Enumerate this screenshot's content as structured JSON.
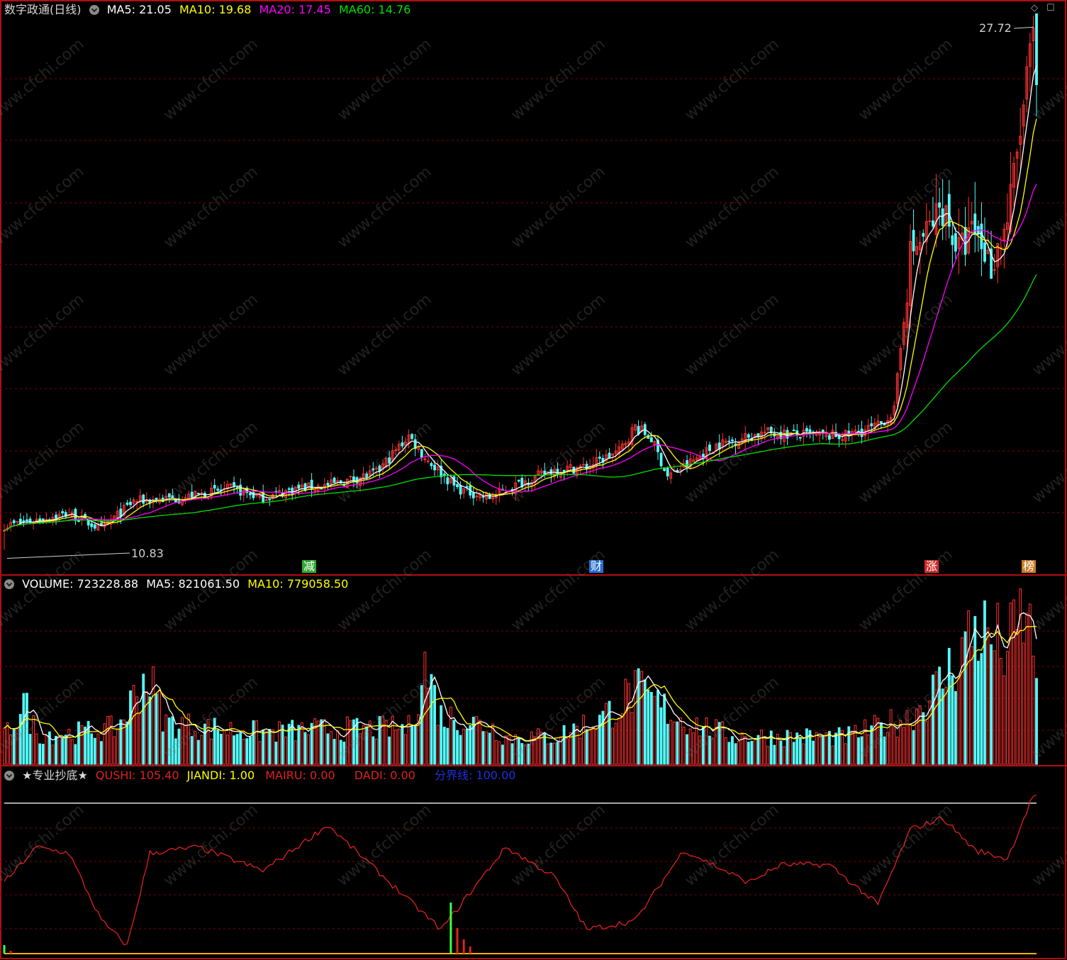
{
  "panel1": {
    "title": "数字政通(日线)",
    "ma5_label": "MA5: 21.05",
    "ma10_label": "MA10: 19.68",
    "ma20_label": "MA20: 17.45",
    "ma60_label": "MA60: 14.76",
    "high_label": "27.72",
    "low_label": "10.83",
    "badges": [
      {
        "text": "减",
        "color": "#2fa82f"
      },
      {
        "text": "财",
        "color": "#2a6fd0"
      },
      {
        "text": "涨",
        "color": "#d02a2a"
      },
      {
        "text": "榜",
        "color": "#c77a2a"
      }
    ]
  },
  "panel2": {
    "volume_label": "VOLUME: 723228.88",
    "ma5_label": "MA5: 821061.50",
    "ma10_label": "MA10: 779058.50"
  },
  "panel3": {
    "name_label": "★专业抄底★",
    "qushi_label": "QUSHI: 105.40",
    "jiandi_label": "JIANDI: 1.00",
    "mairu_label": "MAIRU: 0.00",
    "dadi_label": "DADI: 0.00",
    "fenjie_label": "分界线: 100.00"
  },
  "watermark": "www.cfchi.com",
  "colors": {
    "up": "#ff3232",
    "down": "#54fcfc",
    "ma5": "#ffffff",
    "ma10": "#ffff00",
    "ma20": "#ff00ff",
    "ma60": "#00e000",
    "grid": "#800000",
    "border": "#b01010",
    "qushi": "#e02020",
    "fenjie": "#e0e0e0",
    "base": "#ffb000"
  },
  "chart_data": [
    {
      "type": "candlestick",
      "title": "数字政通(日线)",
      "y_range": [
        10.5,
        28.0
      ],
      "high": 27.72,
      "low": 10.83,
      "ma_latest": {
        "MA5": 21.05,
        "MA10": 19.68,
        "MA20": 17.45,
        "MA60": 14.76
      },
      "close_trend": [
        [
          0,
          11.6
        ],
        [
          20,
          12.0
        ],
        [
          30,
          11.5
        ],
        [
          40,
          12.4
        ],
        [
          55,
          12.5
        ],
        [
          70,
          12.8
        ],
        [
          80,
          12.5
        ],
        [
          90,
          12.8
        ],
        [
          100,
          12.9
        ],
        [
          115,
          13.3
        ],
        [
          125,
          14.5
        ],
        [
          130,
          13.8
        ],
        [
          140,
          12.8
        ],
        [
          150,
          12.5
        ],
        [
          160,
          13.0
        ],
        [
          170,
          13.4
        ],
        [
          180,
          13.5
        ],
        [
          190,
          14.0
        ],
        [
          195,
          14.8
        ],
        [
          200,
          14.4
        ],
        [
          205,
          13.2
        ],
        [
          210,
          13.5
        ],
        [
          220,
          14.2
        ],
        [
          235,
          14.6
        ],
        [
          250,
          14.5
        ],
        [
          260,
          14.5
        ],
        [
          270,
          14.8
        ],
        [
          275,
          15.3
        ],
        [
          280,
          20.3
        ],
        [
          285,
          21.0
        ],
        [
          290,
          21.9
        ],
        [
          295,
          20.4
        ],
        [
          300,
          21.1
        ],
        [
          305,
          20.0
        ],
        [
          310,
          21.4
        ],
        [
          315,
          25.0
        ],
        [
          318,
          27.4
        ]
      ]
    },
    {
      "type": "bar",
      "title": "VOLUME",
      "latest": {
        "VOLUME": 723228.88,
        "MA5": 821061.5,
        "MA10": 779058.5
      },
      "volume_trend": [
        [
          0,
          240000
        ],
        [
          6,
          550000
        ],
        [
          10,
          270000
        ],
        [
          20,
          270000
        ],
        [
          35,
          320000
        ],
        [
          44,
          800000
        ],
        [
          50,
          370000
        ],
        [
          60,
          330000
        ],
        [
          80,
          280000
        ],
        [
          100,
          310000
        ],
        [
          110,
          310000
        ],
        [
          125,
          320000
        ],
        [
          130,
          870000
        ],
        [
          135,
          430000
        ],
        [
          150,
          340000
        ],
        [
          155,
          240000
        ],
        [
          170,
          240000
        ],
        [
          185,
          420000
        ],
        [
          195,
          650000
        ],
        [
          210,
          390000
        ],
        [
          225,
          250000
        ],
        [
          260,
          240000
        ],
        [
          268,
          310000
        ],
        [
          280,
          420000
        ],
        [
          290,
          730000
        ],
        [
          300,
          1220000
        ],
        [
          310,
          1000000
        ],
        [
          315,
          1330000
        ],
        [
          318,
          1050000
        ]
      ]
    },
    {
      "type": "line",
      "title": "★专业抄底★",
      "latest": {
        "QUSHI": 105.4,
        "JIANDI": 1.0,
        "MAIRU": 0.0,
        "DADI": 0.0,
        "分界线": 100.0
      },
      "series": [
        {
          "name": "QUSHI",
          "points": [
            [
              0,
              46
            ],
            [
              10,
              70
            ],
            [
              20,
              66
            ],
            [
              30,
              20
            ],
            [
              38,
              3
            ],
            [
              45,
              66
            ],
            [
              60,
              70
            ],
            [
              80,
              54
            ],
            [
              100,
              85
            ],
            [
              125,
              34
            ],
            [
              135,
              14
            ],
            [
              155,
              70
            ],
            [
              170,
              50
            ],
            [
              180,
              14
            ],
            [
              195,
              20
            ],
            [
              210,
              68
            ],
            [
              230,
              46
            ],
            [
              240,
              58
            ],
            [
              255,
              58
            ],
            [
              270,
              31
            ],
            [
              280,
              82
            ],
            [
              290,
              90
            ],
            [
              300,
              68
            ],
            [
              310,
              62
            ],
            [
              318,
              105.4
            ]
          ]
        },
        {
          "name": "分界线",
          "constant": 100.0
        }
      ]
    }
  ]
}
